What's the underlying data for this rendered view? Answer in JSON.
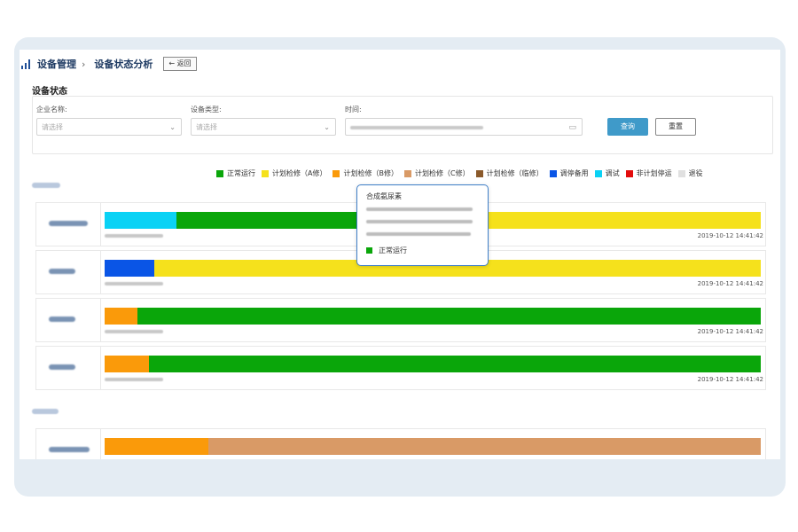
{
  "header": {
    "crumb_parent": "设备管理",
    "crumb_sep": "›",
    "crumb_current": "设备状态分析",
    "back_label": "← 返回"
  },
  "section_title": "设备状态",
  "filter": {
    "company_label": "企业名称:",
    "company_placeholder": "请选择",
    "type_label": "设备类型:",
    "type_placeholder": "请选择",
    "time_label": "时间:",
    "query_label": "查询",
    "reset_label": "重置",
    "chevron": "⌄",
    "calendar": "▭"
  },
  "legend": [
    {
      "label": "正常运行",
      "color": "#0aa60a"
    },
    {
      "label": "计划检修（A修）",
      "color": "#f5e11c"
    },
    {
      "label": "计划检修（B修）",
      "color": "#fa9a0a"
    },
    {
      "label": "计划检修（C修）",
      "color": "#d99a66"
    },
    {
      "label": "计划检修（临修）",
      "color": "#8b5a2b"
    },
    {
      "label": "调停备用",
      "color": "#0a55e6"
    },
    {
      "label": "调试",
      "color": "#0ad2f5"
    },
    {
      "label": "非计划停运",
      "color": "#e30d0d"
    },
    {
      "label": "退役",
      "color": "#e0e0e0"
    }
  ],
  "rows": [
    {
      "segments": [
        {
          "color": "#0ad2f5",
          "share": 0.11
        },
        {
          "color": "#0aa60a",
          "share": 0.43
        },
        {
          "color": "#f5e11c",
          "share": 0.46
        }
      ],
      "end_time": "2019-10-12 14:41:42"
    },
    {
      "segments": [
        {
          "color": "#0a55e6",
          "share": 0.076
        },
        {
          "color": "#f5e11c",
          "share": 0.924
        }
      ],
      "end_time": "2019-10-12 14:41:42"
    },
    {
      "segments": [
        {
          "color": "#fa9a0a",
          "share": 0.05
        },
        {
          "color": "#0aa60a",
          "share": 0.95
        }
      ],
      "end_time": "2019-10-12 14:41:42"
    },
    {
      "segments": [
        {
          "color": "#fa9a0a",
          "share": 0.067
        },
        {
          "color": "#0aa60a",
          "share": 0.933
        }
      ],
      "end_time": "2019-10-12 14:41:42"
    },
    {
      "segments": [
        {
          "color": "#fa9a0a",
          "share": 0.158
        },
        {
          "color": "#d99a66",
          "share": 0.842
        }
      ],
      "end_time": ""
    }
  ],
  "tooltip": {
    "title": "合成氨尿素",
    "status": "正常运行",
    "status_color": "#0aa60a"
  }
}
